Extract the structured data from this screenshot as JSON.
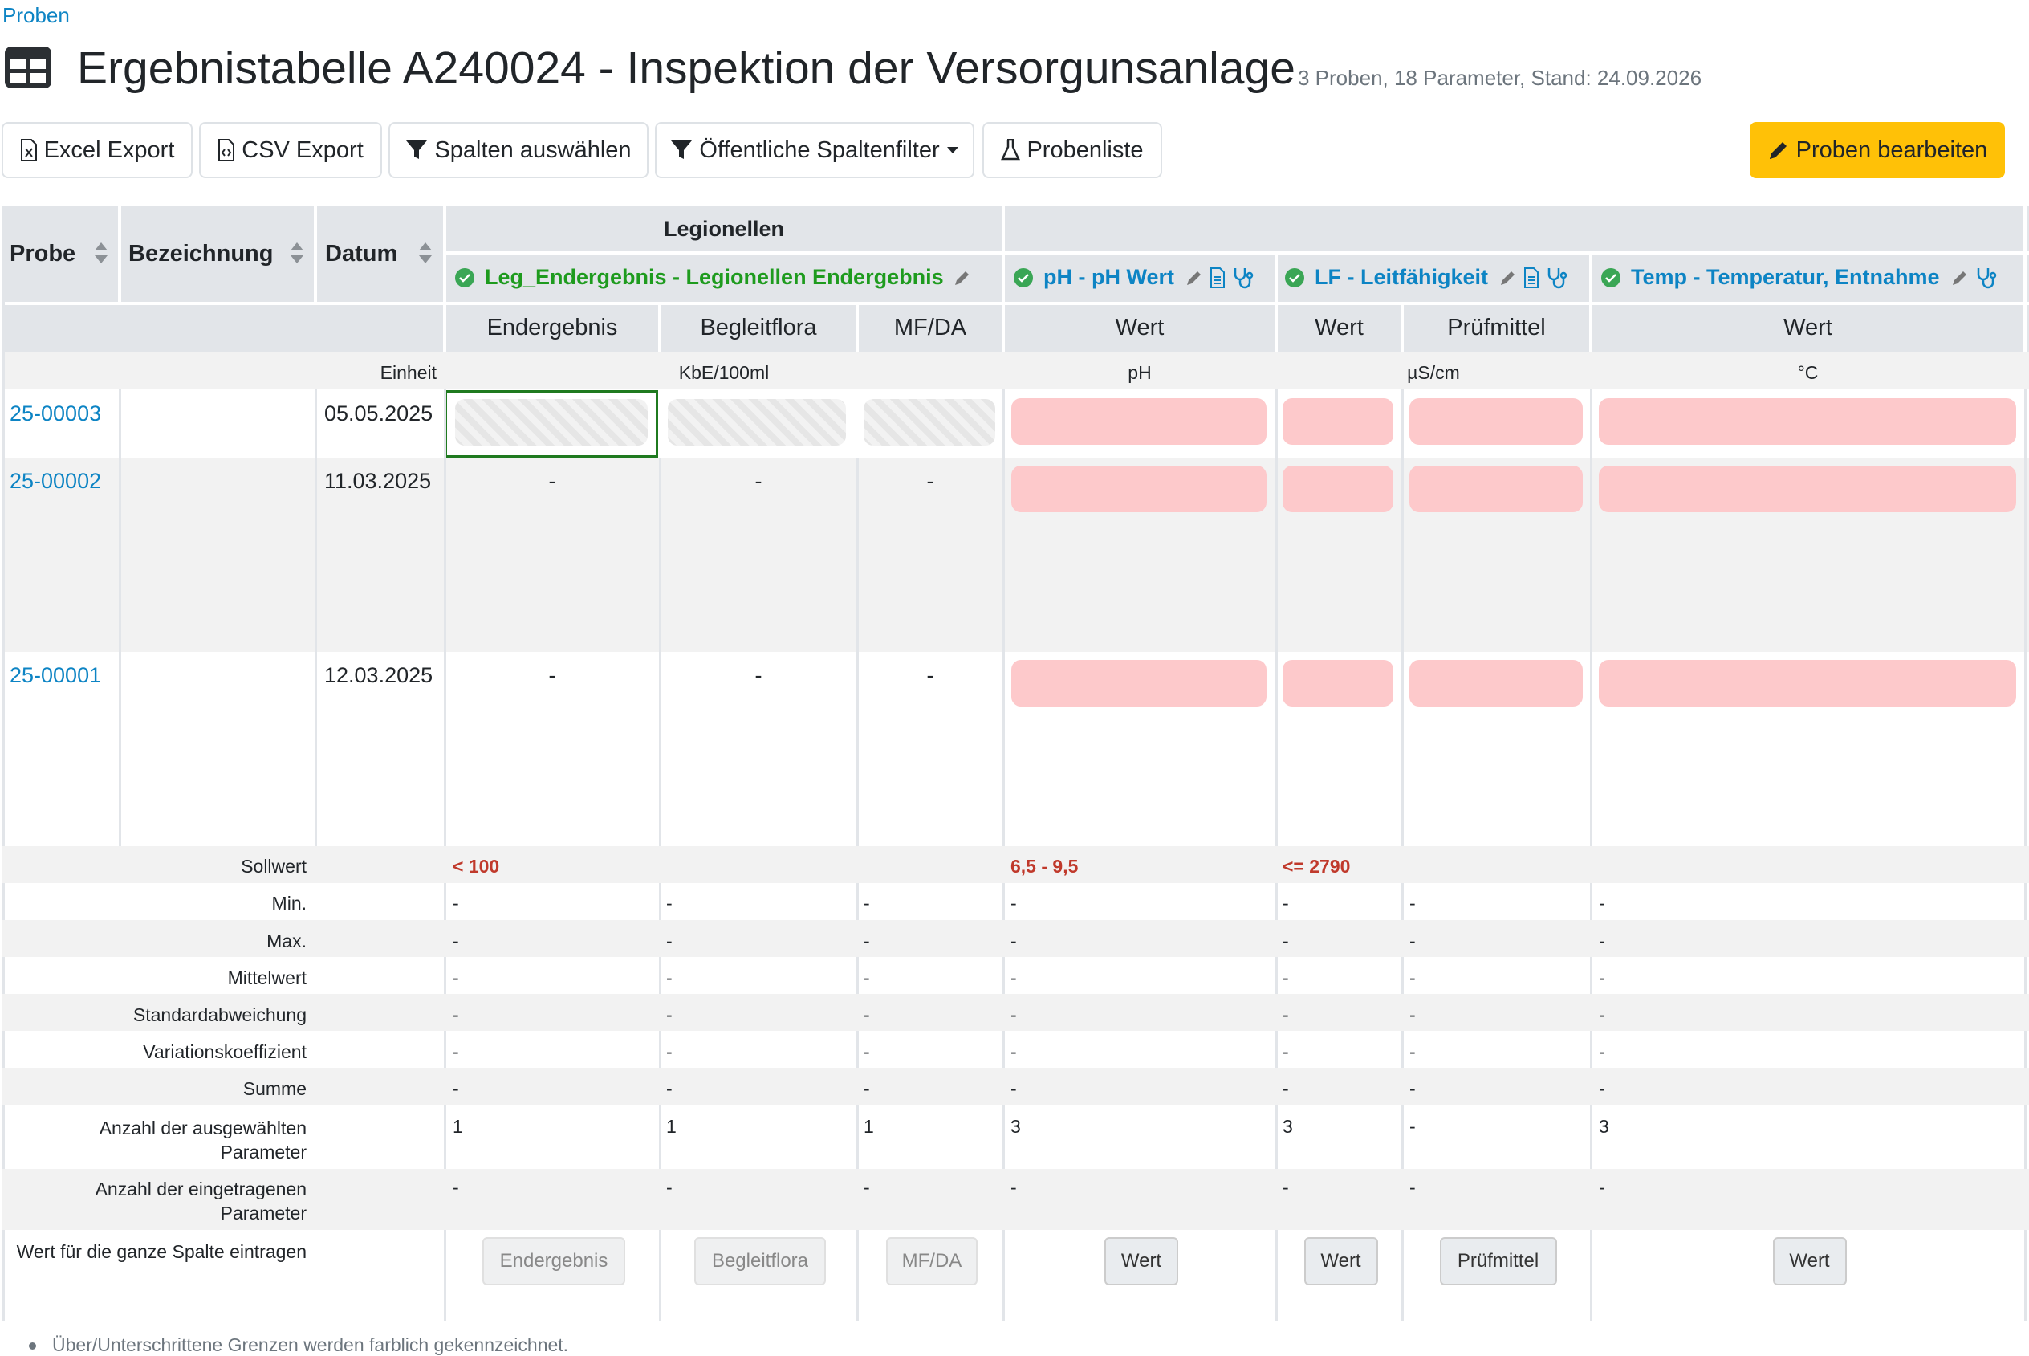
{
  "breadcrumb": "Proben",
  "title": "Ergebnistabelle A240024 - Inspektion der Versorgunsanlage",
  "subtitle": "3 Proben, 18 Parameter, Stand: 24.09.2026",
  "toolbar": {
    "excel": "Excel Export",
    "csv": "CSV Export",
    "columns": "Spalten auswählen",
    "filter": "Öffentliche Spaltenfilter",
    "list": "Probenliste",
    "edit": "Proben bearbeiten"
  },
  "table": {
    "col_probe": "Probe",
    "col_bezeichnung": "Bezeichnung",
    "col_datum": "Datum",
    "group_legionellen": "Legionellen",
    "params": {
      "leg": "Leg_Endergebnis - Legionellen Endergebnis",
      "ph": "pH - pH Wert",
      "lf": "LF - Leitfähigkeit",
      "temp": "Temp - Temperatur, Entnahme"
    },
    "subcols": {
      "leg1": "Endergebnis",
      "leg2": "Begleitflora",
      "leg3": "MF/DA",
      "ph": "Wert",
      "lf1": "Wert",
      "lf2": "Prüfmittel",
      "temp": "Wert"
    },
    "unit_label": "Einheit",
    "units": {
      "leg": "KbE/100ml",
      "ph": "pH",
      "lf": "µS/cm",
      "temp": "°C"
    },
    "rows": [
      {
        "probe": "25-00003",
        "datum": "05.05.2025",
        "leg1": "",
        "leg2": "",
        "leg3": ""
      },
      {
        "probe": "25-00002",
        "datum": "11.03.2025",
        "leg1": "-",
        "leg2": "-",
        "leg3": "-"
      },
      {
        "probe": "25-00001",
        "datum": "12.03.2025",
        "leg1": "-",
        "leg2": "-",
        "leg3": "-"
      }
    ],
    "sollwert": {
      "label": "Sollwert",
      "leg": "< 100",
      "ph": "6,5 - 9,5",
      "lf": "<= 2790"
    },
    "stats": [
      {
        "label": "Min.",
        "vals": [
          "-",
          "-",
          "-",
          "-",
          "-",
          "-",
          "-"
        ]
      },
      {
        "label": "Max.",
        "vals": [
          "-",
          "-",
          "-",
          "-",
          "-",
          "-",
          "-"
        ]
      },
      {
        "label": "Mittelwert",
        "vals": [
          "-",
          "-",
          "-",
          "-",
          "-",
          "-",
          "-"
        ]
      },
      {
        "label": "Standardabweichung",
        "vals": [
          "-",
          "-",
          "-",
          "-",
          "-",
          "-",
          "-"
        ]
      },
      {
        "label": "Variationskoeffizient",
        "vals": [
          "-",
          "-",
          "-",
          "-",
          "-",
          "-",
          "-"
        ]
      },
      {
        "label": "Summe",
        "vals": [
          "-",
          "-",
          "-",
          "-",
          "-",
          "-",
          "-"
        ]
      }
    ],
    "anzahl_ausgewaehlt": {
      "label1": "Anzahl der ausgewählten",
      "label2": "Parameter",
      "vals": [
        "1",
        "1",
        "1",
        "3",
        "3",
        "-",
        "3"
      ]
    },
    "anzahl_eingetragen": {
      "label1": "Anzahl der eingetragenen",
      "label2": "Parameter",
      "vals": [
        "-",
        "-",
        "-",
        "-",
        "-",
        "-",
        "-"
      ]
    },
    "fill_label": "Wert für die ganze Spalte eintragen",
    "fill_buttons": [
      "Endergebnis",
      "Begleitflora",
      "MF/DA",
      "Wert",
      "Wert",
      "Prüfmittel",
      "Wert"
    ]
  },
  "footnote": "Über/Unterschrittene Grenzen werden farblich gekennzeichnet."
}
